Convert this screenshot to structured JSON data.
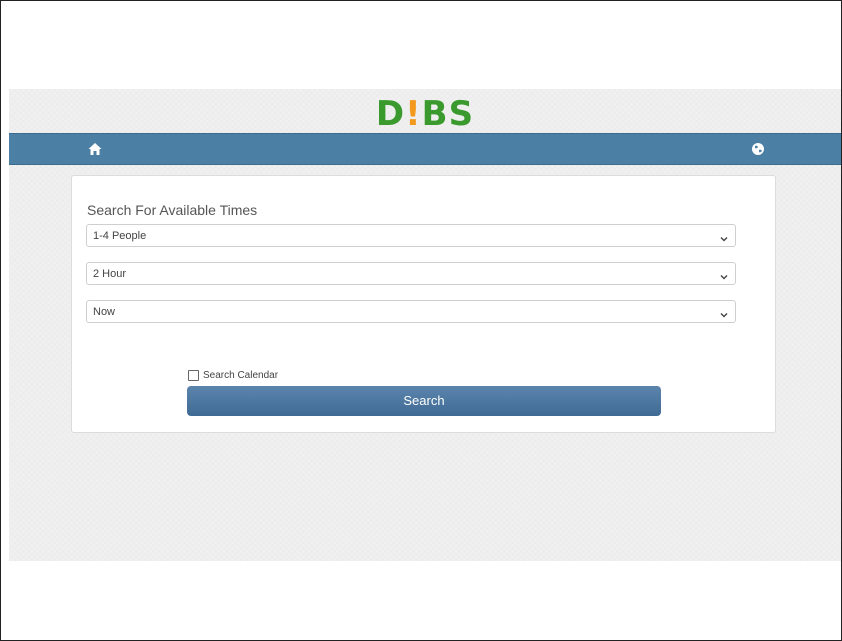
{
  "logo": {
    "part1": "D",
    "part2": "!",
    "part3": "BS"
  },
  "nav": {
    "home_icon": "home-icon",
    "globe_icon": "globe-icon"
  },
  "search": {
    "title": "Search For Available Times",
    "people": "1-4 People",
    "duration": "2 Hour",
    "time": "Now",
    "calendar_label": "Search Calendar",
    "calendar_checked": false,
    "button_label": "Search"
  },
  "colors": {
    "nav_bar": "#4b7fa3",
    "button": "#4a76a0",
    "logo_green": "#3a9a2e",
    "logo_orange": "#f39a1e"
  }
}
